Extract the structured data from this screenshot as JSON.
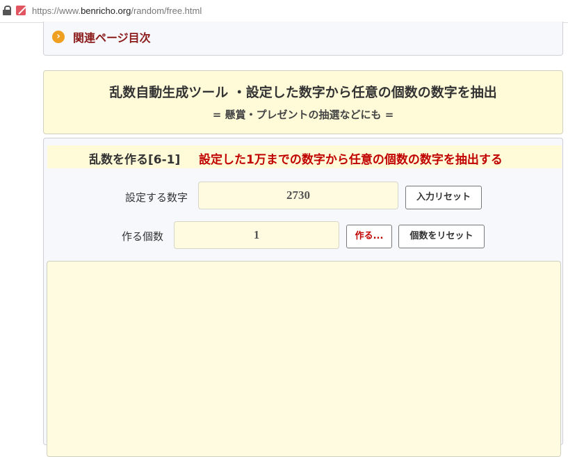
{
  "browser": {
    "url_prefix": "https://www.",
    "url_domain": "benricho.org",
    "url_path": "/random/free.html"
  },
  "related": {
    "link_label": "関連ページ目次"
  },
  "header": {
    "title": "乱数自動生成ツール ・設定した数字から任意の個数の数字を抽出",
    "subtitle": "= 懸賞・プレゼントの抽選などにも ="
  },
  "tool": {
    "heading_label": "乱数を作る[6-1]",
    "heading_description": "設定した1万までの数字から任意の個数の数字を抽出する",
    "number_label": "設定する数字",
    "number_value": "2730",
    "reset_input_button": "入力リセット",
    "count_label": "作る個数",
    "count_value": "1",
    "generate_button": "作る...",
    "reset_count_button": "個数をリセット",
    "output_value": ""
  },
  "colors": {
    "accent_red": "#c00000",
    "link_dark_red": "#8b1a1a",
    "cream": "#fffbd8",
    "chevron_orange": "#f0a020"
  },
  "icons": [
    "lock-icon",
    "site-favicon-icon",
    "chevron-right-circle-icon"
  ]
}
